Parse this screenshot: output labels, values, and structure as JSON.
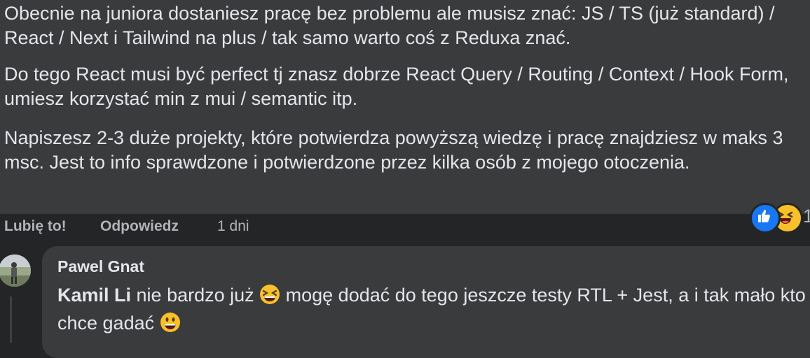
{
  "comment": {
    "paragraphs": [
      "Obecnie na juniora dostaniesz pracę bez problemu ale musisz znać: JS / TS (już standard) / React / Next i Tailwind na plus / tak samo warto coś z Reduxa znać.",
      "Do tego React musi być perfect tj znasz dobrze React Query / Routing / Context / Hook Form, umiesz korzystać min z mui / semantic itp.",
      "Napiszesz 2-3 duże projekty, które potwierdza powyższą wiedzę i pracę znajdziesz w maks 3 msc. Jest to info sprawdzone i potwierdzone przez kilka osób z mojego otoczenia."
    ],
    "reactions": {
      "icons": [
        "like-icon",
        "haha-icon"
      ],
      "count": "1"
    }
  },
  "actions": {
    "like": "Lubię to!",
    "reply": "Odpowiedz",
    "time": "1 dni"
  },
  "reply": {
    "author": "Pawel Gnat",
    "mention": "Kamil Li",
    "text_part1": " nie bardzo już ",
    "text_part2": " mogę dodać do tego jeszcze testy RTL + Jest, a i tak mało kto chce gadać ",
    "emoji1": "laughing-emoji",
    "emoji2": "grinning-emoji"
  },
  "colors": {
    "background": "#242526",
    "bubble": "#3a3b3c",
    "text": "#e4e6eb",
    "secondary_text": "#b0b3b8",
    "like_blue": "#1877f2",
    "haha_yellow": "#f7c12b"
  }
}
